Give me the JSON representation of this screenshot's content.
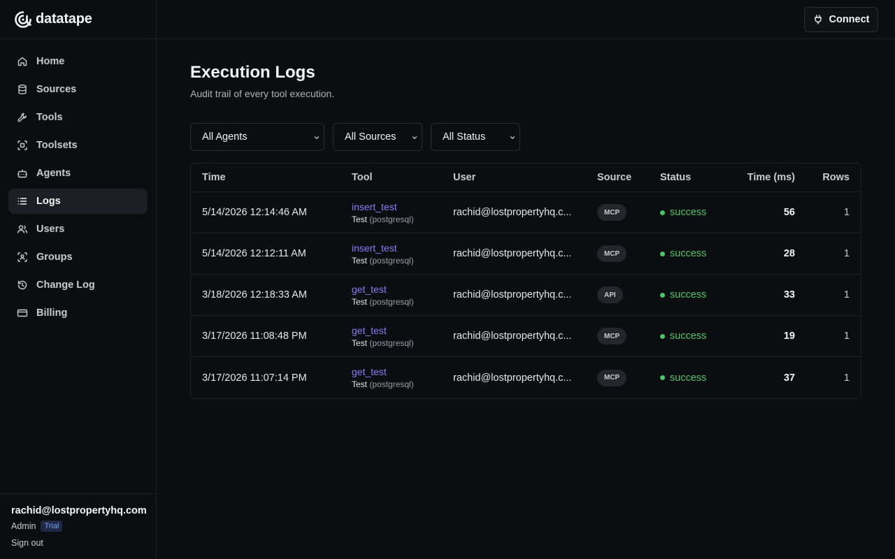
{
  "brand": {
    "name": "datatape"
  },
  "sidebar": {
    "items": [
      {
        "label": "Home",
        "icon": "home-icon"
      },
      {
        "label": "Sources",
        "icon": "database-icon"
      },
      {
        "label": "Tools",
        "icon": "wrench-icon"
      },
      {
        "label": "Toolsets",
        "icon": "scan-icon"
      },
      {
        "label": "Agents",
        "icon": "bot-icon"
      },
      {
        "label": "Logs",
        "icon": "list-icon",
        "active": true
      },
      {
        "label": "Users",
        "icon": "users-icon"
      },
      {
        "label": "Groups",
        "icon": "user-square-icon"
      },
      {
        "label": "Change Log",
        "icon": "history-icon"
      },
      {
        "label": "Billing",
        "icon": "credit-card-icon"
      }
    ]
  },
  "user": {
    "email": "rachid@lostpropertyhq.com",
    "role": "Admin",
    "plan_badge": "Trial",
    "signout_label": "Sign out"
  },
  "topbar": {
    "connect_label": "Connect"
  },
  "page": {
    "title": "Execution Logs",
    "subtitle": "Audit trail of every tool execution."
  },
  "filters": {
    "agents": "All Agents",
    "sources": "All Sources",
    "status": "All Status"
  },
  "table": {
    "headers": {
      "time": "Time",
      "tool": "Tool",
      "user": "User",
      "source": "Source",
      "status": "Status",
      "ms": "Time (ms)",
      "rows": "Rows"
    },
    "rows": [
      {
        "time": "5/14/2026 12:14:46 AM",
        "tool": "insert_test",
        "tool_source": "Test",
        "tool_db": "(postgresql)",
        "user": "rachid@lostpropertyhq.c...",
        "source": "MCP",
        "status": "success",
        "ms": "56",
        "rows": "1"
      },
      {
        "time": "5/14/2026 12:12:11 AM",
        "tool": "insert_test",
        "tool_source": "Test",
        "tool_db": "(postgresql)",
        "user": "rachid@lostpropertyhq.c...",
        "source": "MCP",
        "status": "success",
        "ms": "28",
        "rows": "1"
      },
      {
        "time": "3/18/2026 12:18:33 AM",
        "tool": "get_test",
        "tool_source": "Test",
        "tool_db": "(postgresql)",
        "user": "rachid@lostpropertyhq.c...",
        "source": "API",
        "status": "success",
        "ms": "33",
        "rows": "1"
      },
      {
        "time": "3/17/2026 11:08:48 PM",
        "tool": "get_test",
        "tool_source": "Test",
        "tool_db": "(postgresql)",
        "user": "rachid@lostpropertyhq.c...",
        "source": "MCP",
        "status": "success",
        "ms": "19",
        "rows": "1"
      },
      {
        "time": "3/17/2026 11:07:14 PM",
        "tool": "get_test",
        "tool_source": "Test",
        "tool_db": "(postgresql)",
        "user": "rachid@lostpropertyhq.c...",
        "source": "MCP",
        "status": "success",
        "ms": "37",
        "rows": "1"
      }
    ]
  },
  "colors": {
    "accent": "#8b7cf6",
    "success": "#4cc46a",
    "background": "#0c0d10"
  }
}
